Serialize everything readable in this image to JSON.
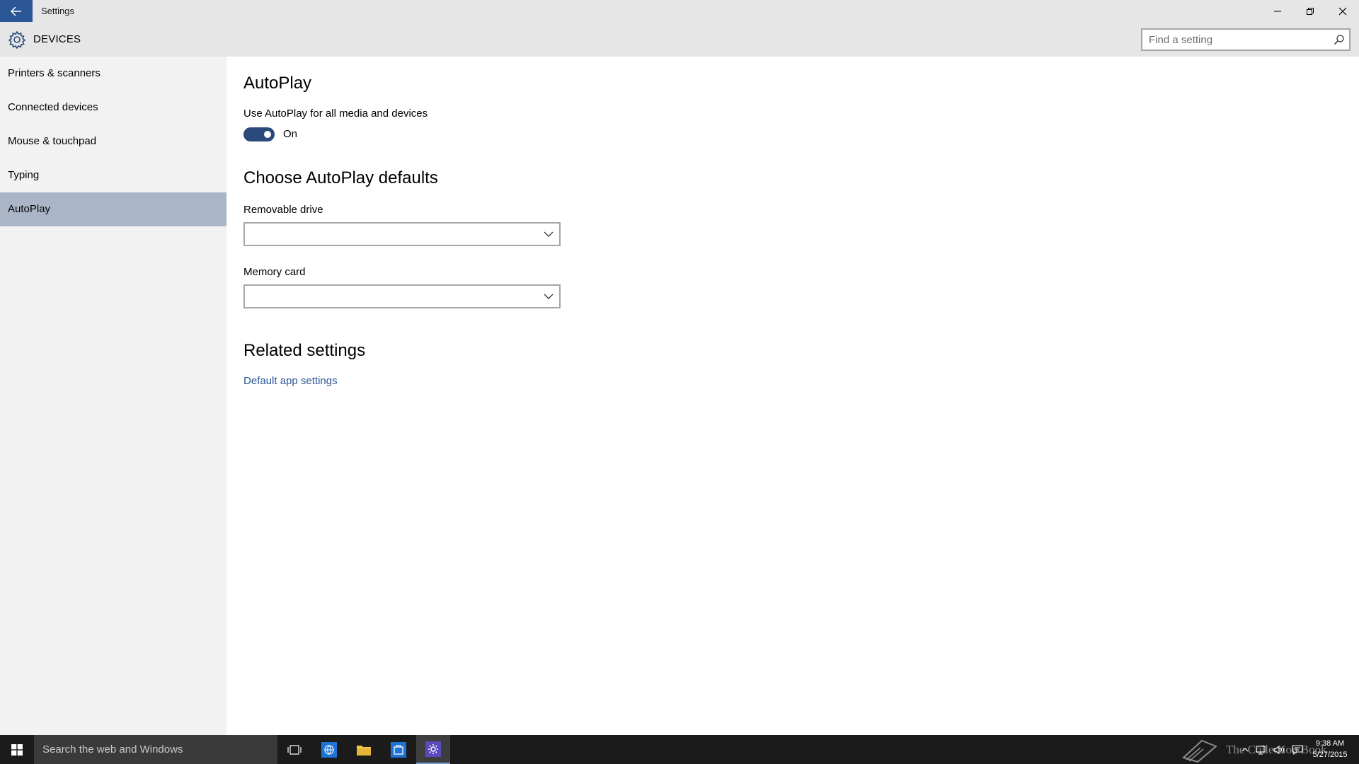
{
  "window": {
    "title": "Settings"
  },
  "header": {
    "title": "DEVICES",
    "search_placeholder": "Find a setting"
  },
  "sidebar": {
    "items": [
      {
        "label": "Printers & scanners"
      },
      {
        "label": "Connected devices"
      },
      {
        "label": "Mouse & touchpad"
      },
      {
        "label": "Typing"
      },
      {
        "label": "AutoPlay",
        "selected": true
      }
    ]
  },
  "content": {
    "title": "AutoPlay",
    "autoplay_label": "Use AutoPlay for all media and devices",
    "autoplay_toggle": {
      "state_label": "On",
      "on": true
    },
    "defaults_title": "Choose AutoPlay defaults",
    "removable_drive": {
      "label": "Removable drive",
      "value": ""
    },
    "memory_card": {
      "label": "Memory card",
      "value": ""
    },
    "related_title": "Related settings",
    "related_link": "Default app settings"
  },
  "taskbar": {
    "search_text": "Search the web and Windows",
    "watermark": "The Collection Book",
    "clock": {
      "time": "9:38 AM",
      "date": "5/27/2015"
    }
  },
  "colors": {
    "accent": "#2b5797",
    "selected_nav": "#aab6c7",
    "toggle_on": "#2b4a7b",
    "chrome": "#e6e6e6",
    "sidebar": "#f2f2f2",
    "taskbar": "#1b1b1b"
  }
}
